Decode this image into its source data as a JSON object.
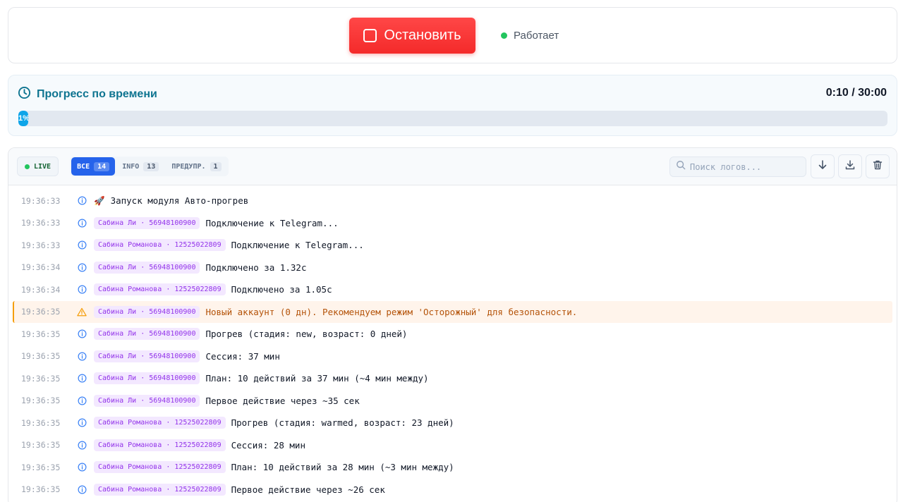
{
  "control": {
    "stop_label": "Остановить",
    "status_text": "Работает",
    "status_color": "#22c55e",
    "stop_color": "#f42a2a"
  },
  "progress": {
    "title": "Прогресс по времени",
    "time": "0:10 / 30:00",
    "percent_label": "1%",
    "percent": 1
  },
  "logs": {
    "live_label": "LIVE",
    "tabs": [
      {
        "label": "ВСЕ",
        "count": "14",
        "active": true
      },
      {
        "label": "INFO",
        "count": "13",
        "active": false
      },
      {
        "label": "ПРЕДУПР.",
        "count": "1",
        "active": false
      }
    ],
    "search_placeholder": "Поиск логов...",
    "rows": [
      {
        "time": "19:36:33",
        "level": "info",
        "account": "",
        "emoji": "🚀",
        "message": "Запуск модуля Авто-прогрев"
      },
      {
        "time": "19:36:33",
        "level": "info",
        "account": "Сабина Ли · 56948100900",
        "message": "Подключение к Telegram..."
      },
      {
        "time": "19:36:33",
        "level": "info",
        "account": "Сабина Романова · 12525022809",
        "message": "Подключение к Telegram..."
      },
      {
        "time": "19:36:34",
        "level": "info",
        "account": "Сабина Ли · 56948100900",
        "message": "Подключено за 1.32с"
      },
      {
        "time": "19:36:34",
        "level": "info",
        "account": "Сабина Романова · 12525022809",
        "message": "Подключено за 1.05с"
      },
      {
        "time": "19:36:35",
        "level": "warn",
        "account": "Сабина Ли · 56948100900",
        "message": "Новый аккаунт (0 дн). Рекомендуем режим 'Осторожный' для безопасности."
      },
      {
        "time": "19:36:35",
        "level": "info",
        "account": "Сабина Ли · 56948100900",
        "message": "Прогрев (стадия: new, возраст: 0 дней)"
      },
      {
        "time": "19:36:35",
        "level": "info",
        "account": "Сабина Ли · 56948100900",
        "message": "Сессия: 37 мин"
      },
      {
        "time": "19:36:35",
        "level": "info",
        "account": "Сабина Ли · 56948100900",
        "message": "План: 10 действий за 37 мин (~4 мин между)"
      },
      {
        "time": "19:36:35",
        "level": "info",
        "account": "Сабина Ли · 56948100900",
        "message": "Первое действие через ~35 сек"
      },
      {
        "time": "19:36:35",
        "level": "info",
        "account": "Сабина Романова · 12525022809",
        "message": "Прогрев (стадия: warmed, возраст: 23 дней)"
      },
      {
        "time": "19:36:35",
        "level": "info",
        "account": "Сабина Романова · 12525022809",
        "message": "Сессия: 28 мин"
      },
      {
        "time": "19:36:35",
        "level": "info",
        "account": "Сабина Романова · 12525022809",
        "message": "План: 10 действий за 28 мин (~3 мин между)"
      },
      {
        "time": "19:36:35",
        "level": "info",
        "account": "Сабина Романова · 12525022809",
        "message": "Первое действие через ~26 сек"
      }
    ]
  },
  "icons": {
    "info": "info-circle-icon",
    "warn": "warning-triangle-icon",
    "clock": "clock-icon",
    "search": "search-icon",
    "scroll": "arrow-down-icon",
    "download": "download-icon",
    "clear": "trash-icon"
  }
}
